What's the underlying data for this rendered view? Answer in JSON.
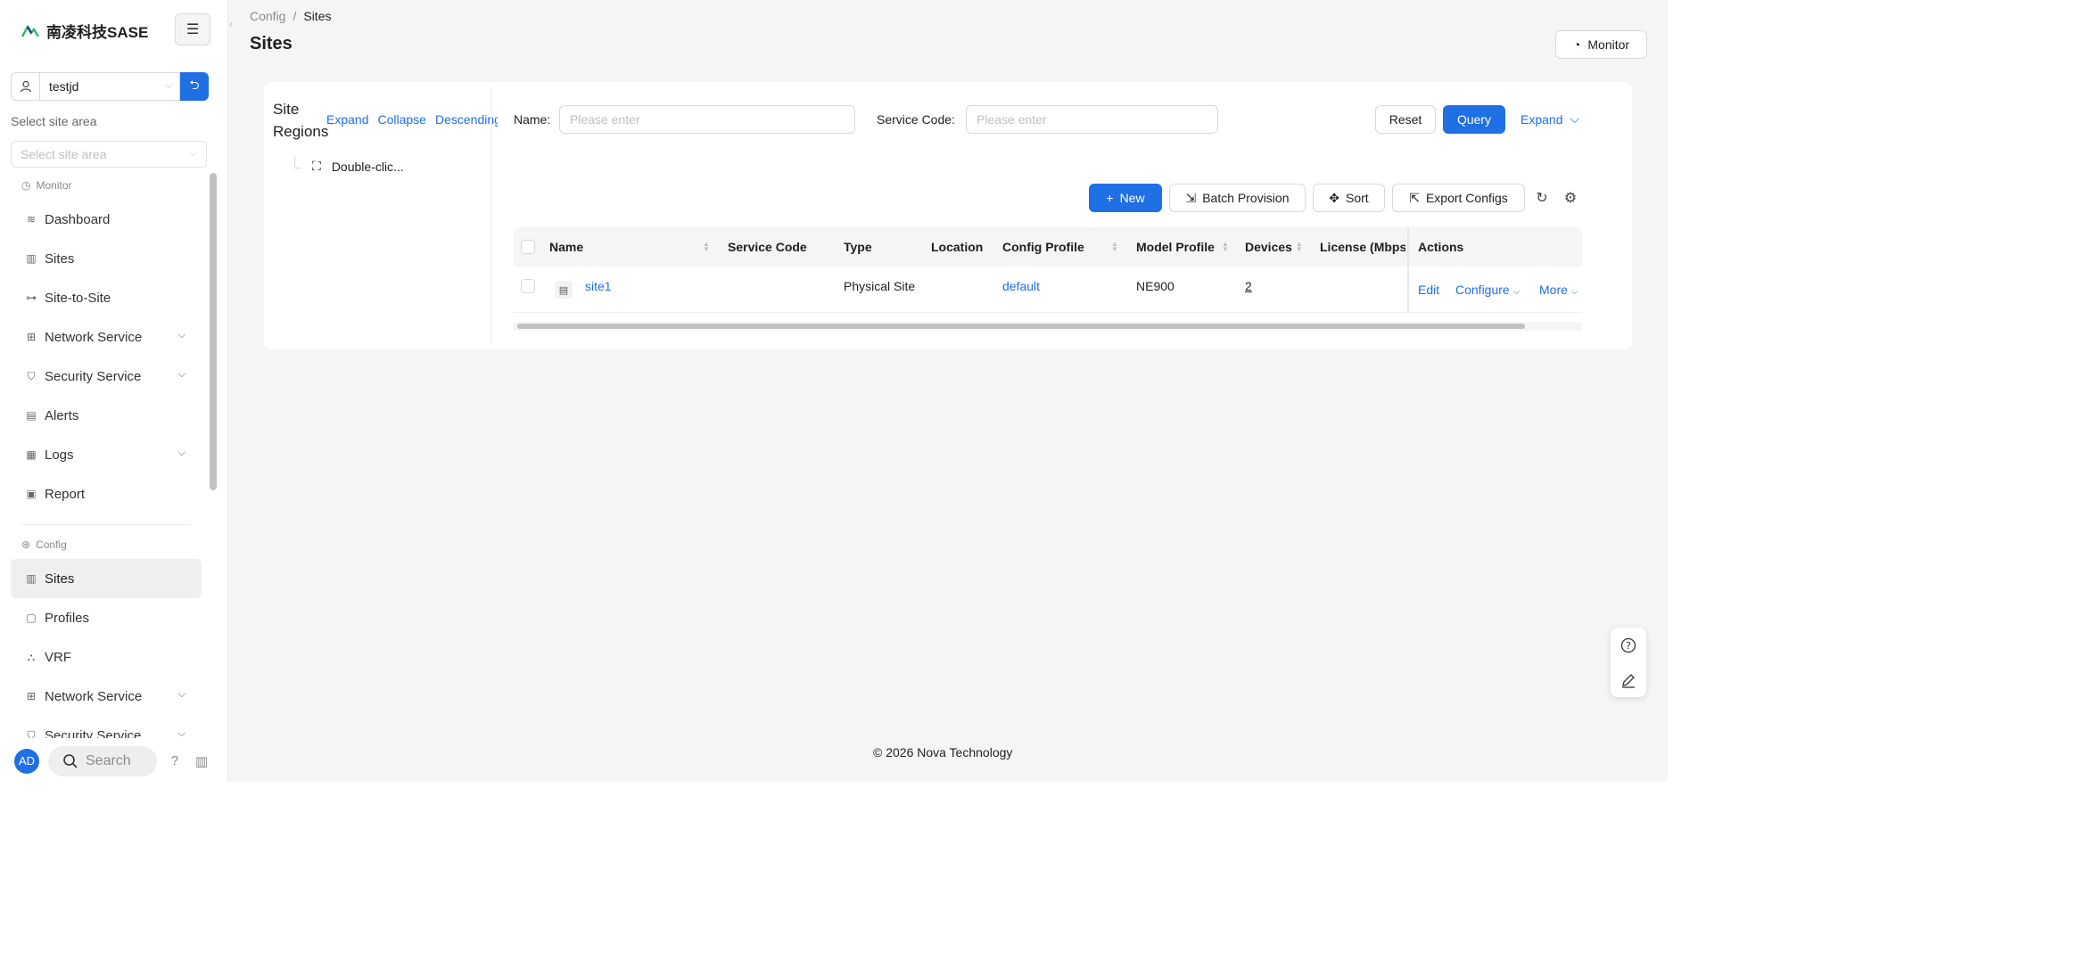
{
  "app": {
    "name": "南凌科技SASE"
  },
  "tenant": {
    "value": "testjd"
  },
  "site_area": {
    "label": "Select site area",
    "placeholder": "Select site area"
  },
  "nav": {
    "monitor_group": "Monitor",
    "monitor_items": [
      {
        "label": "Dashboard",
        "icon": "dashboard-icon"
      },
      {
        "label": "Sites",
        "icon": "building-icon"
      },
      {
        "label": "Site-to-Site",
        "icon": "link-icon"
      },
      {
        "label": "Network Service",
        "icon": "network-icon",
        "expandable": true
      },
      {
        "label": "Security Service",
        "icon": "shield-icon",
        "expandable": true
      },
      {
        "label": "Alerts",
        "icon": "alert-icon"
      },
      {
        "label": "Logs",
        "icon": "logs-icon",
        "expandable": true
      },
      {
        "label": "Report",
        "icon": "report-icon"
      }
    ],
    "config_group": "Config",
    "config_items": [
      {
        "label": "Sites",
        "icon": "building-icon",
        "active": true
      },
      {
        "label": "Profiles",
        "icon": "profile-icon"
      },
      {
        "label": "VRF",
        "icon": "vrf-icon"
      },
      {
        "label": "Network Service",
        "icon": "network-icon",
        "expandable": true
      },
      {
        "label": "Security Service",
        "icon": "shield-icon",
        "expandable": true
      }
    ]
  },
  "user": {
    "initials": "AD"
  },
  "search": {
    "placeholder": "Search"
  },
  "breadcrumb": {
    "parent": "Config",
    "sep": "/",
    "current": "Sites"
  },
  "page": {
    "title": "Sites",
    "monitor_label": "Monitor"
  },
  "tree": {
    "title": "Site Regions",
    "expand": "Expand",
    "collapse": "Collapse",
    "descending": "Descending",
    "node": "Double-clic..."
  },
  "filters": {
    "name_label": "Name",
    "name_placeholder": "Please enter",
    "code_label": "Service Code",
    "code_placeholder": "Please enter",
    "reset": "Reset",
    "query": "Query",
    "expand": "Expand"
  },
  "toolbar": {
    "new": "New",
    "batch": "Batch Provision",
    "sort": "Sort",
    "export": "Export Configs"
  },
  "table": {
    "columns": [
      "Name",
      "Service Code",
      "Type",
      "Location",
      "Config Profile",
      "Model Profile",
      "Devices",
      "License (Mbps)",
      "Actions"
    ],
    "rows": [
      {
        "name": "site1",
        "service_code": "",
        "type": "Physical Site",
        "location": "",
        "config_profile": "default",
        "model_profile": "NE900",
        "devices": "2",
        "license": ""
      }
    ],
    "actions": {
      "edit": "Edit",
      "configure": "Configure",
      "more": "More"
    }
  },
  "footer": {
    "text": "© 2026 Nova Technology"
  },
  "colors": {
    "primary": "#1f6fe5",
    "background": "#f5f5f5"
  }
}
